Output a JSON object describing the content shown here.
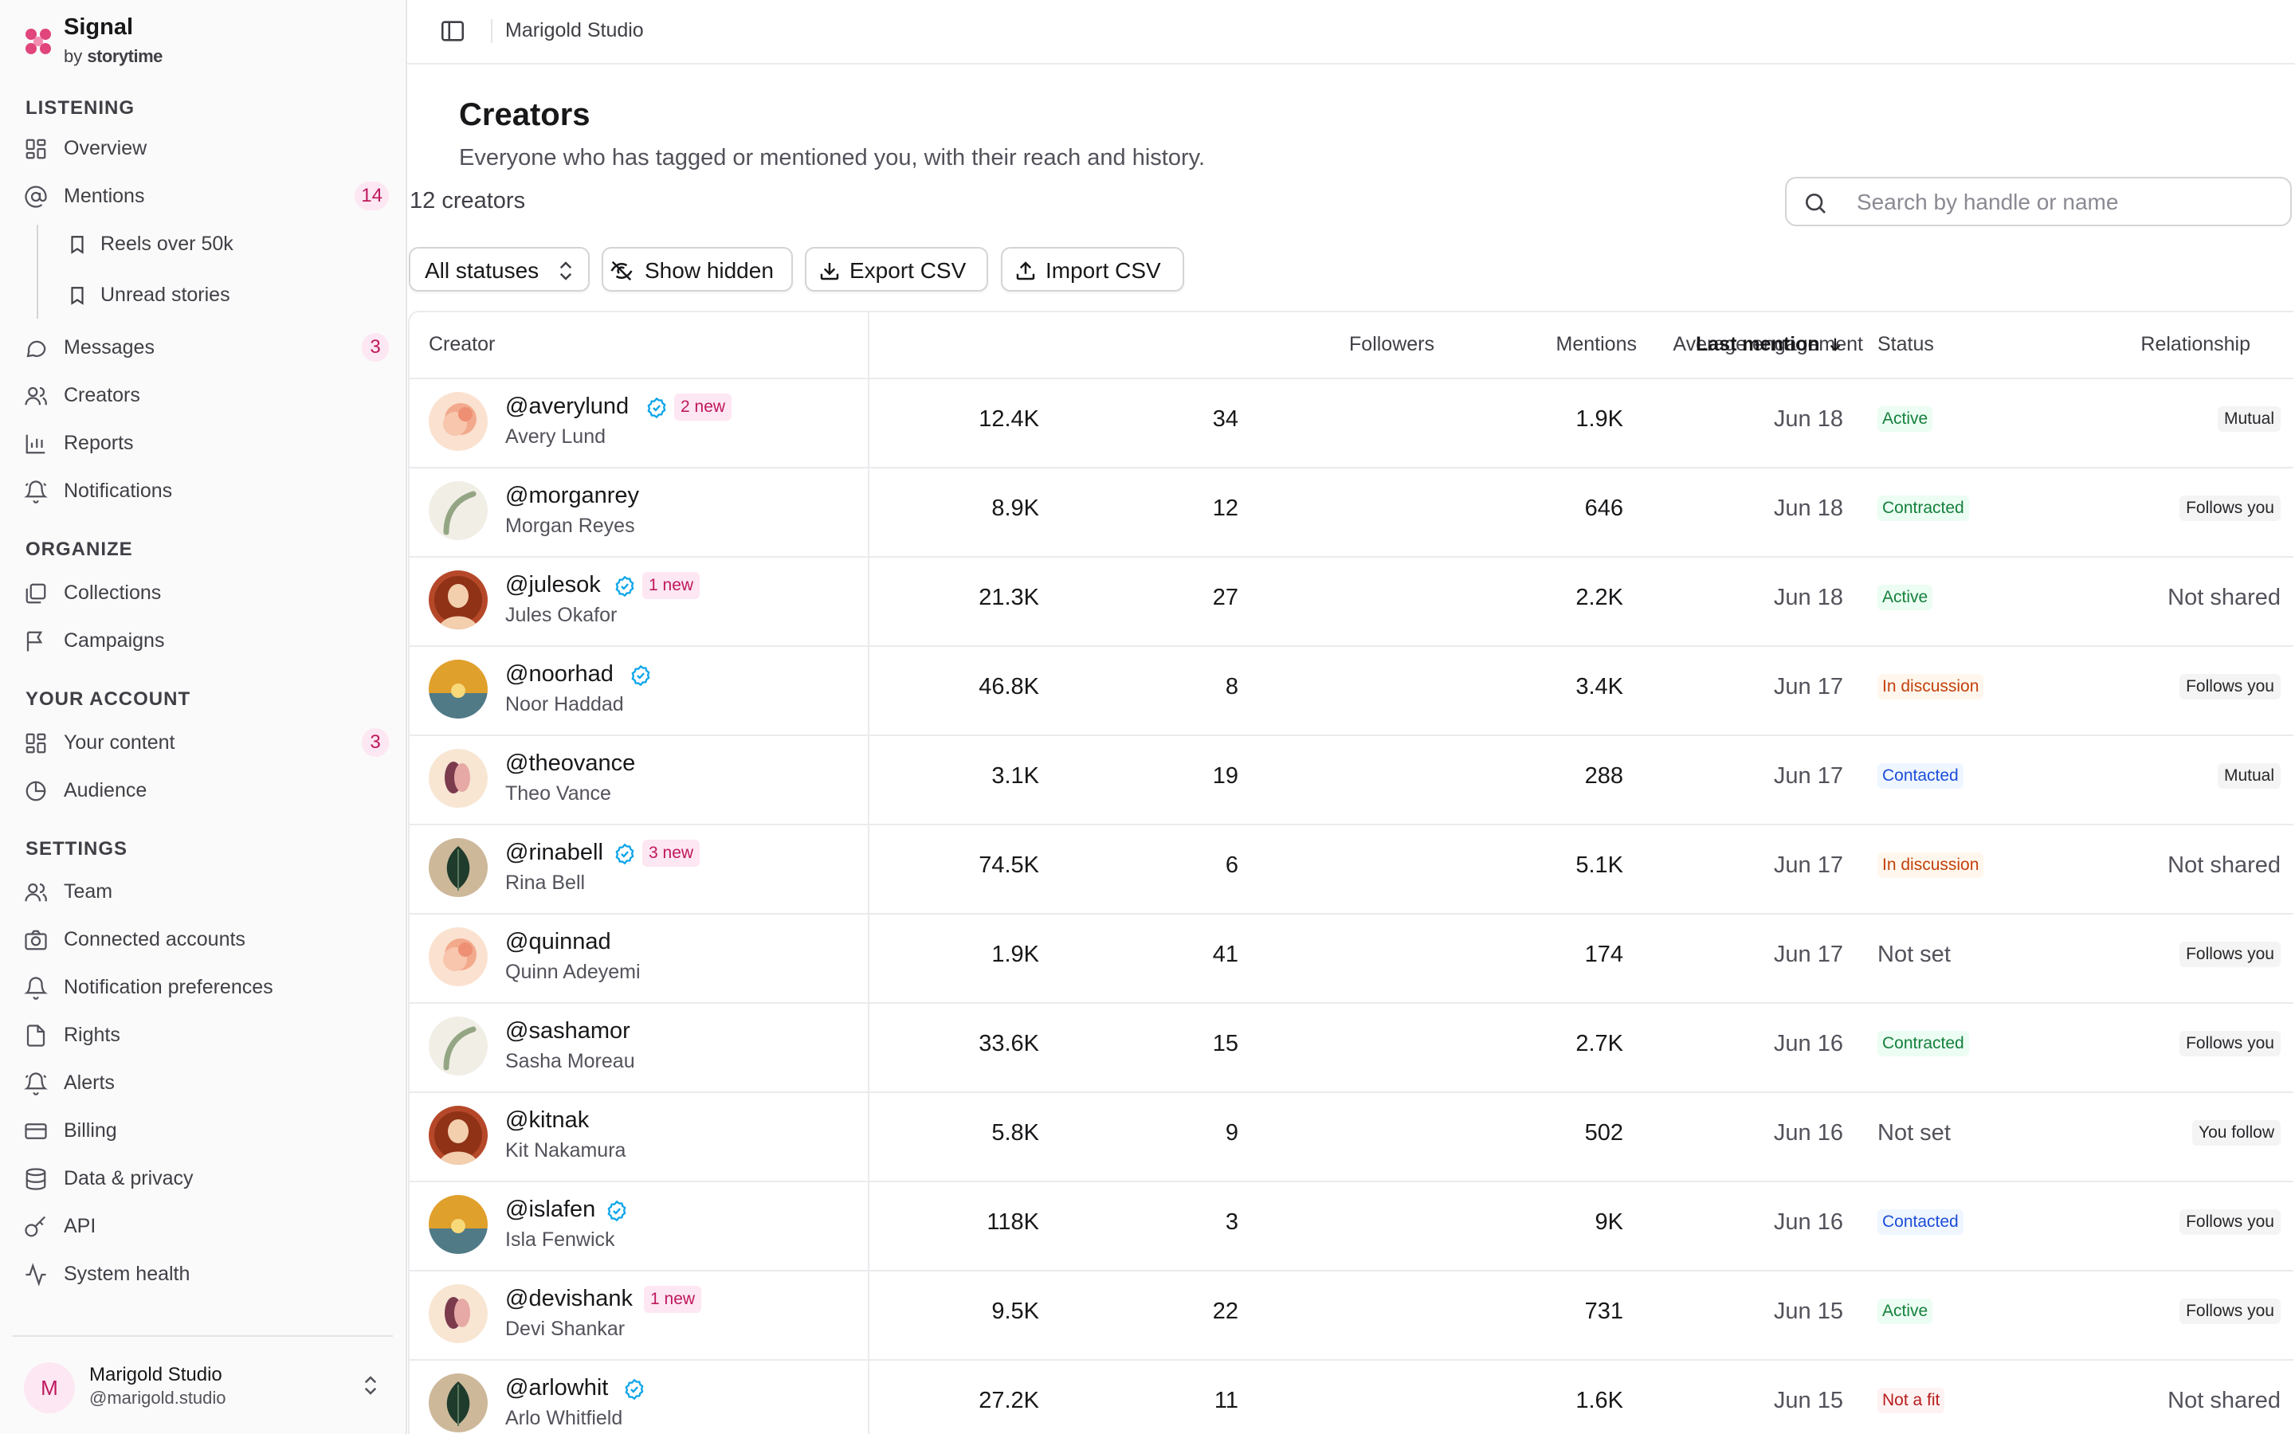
{
  "brand": {
    "name": "Signal",
    "by": "by",
    "company": "storytime",
    "logo_color": "#e0457b"
  },
  "sidebar": {
    "sections": [
      {
        "label": "LISTENING"
      },
      {
        "label": "ORGANIZE"
      },
      {
        "label": "YOUR ACCOUNT"
      },
      {
        "label": "SETTINGS"
      }
    ],
    "items": [
      {
        "label": "Overview",
        "icon": "grid-icon"
      },
      {
        "label": "Mentions",
        "icon": "at-icon",
        "badge": "14"
      },
      {
        "label": "Reels over 50k",
        "icon": "bookmark-icon"
      },
      {
        "label": "Unread stories",
        "icon": "bookmark-icon"
      },
      {
        "label": "Messages",
        "icon": "chat-icon",
        "badge": "3"
      },
      {
        "label": "Creators",
        "icon": "users-icon"
      },
      {
        "label": "Reports",
        "icon": "bar-chart-icon"
      },
      {
        "label": "Notifications",
        "icon": "bell-icon"
      },
      {
        "label": "Collections",
        "icon": "folders-icon"
      },
      {
        "label": "Campaigns",
        "icon": "flag-icon"
      },
      {
        "label": "Your content",
        "icon": "grid-icon",
        "badge": "3"
      },
      {
        "label": "Audience",
        "icon": "pie-icon"
      },
      {
        "label": "Team",
        "icon": "users-icon"
      },
      {
        "label": "Connected accounts",
        "icon": "camera-icon"
      },
      {
        "label": "Notification preferences",
        "icon": "bell-icon"
      },
      {
        "label": "Rights",
        "icon": "document-icon"
      },
      {
        "label": "Alerts",
        "icon": "alarm-icon"
      },
      {
        "label": "Billing",
        "icon": "credit-card-icon"
      },
      {
        "label": "Data & privacy",
        "icon": "database-icon"
      },
      {
        "label": "API",
        "icon": "key-icon"
      },
      {
        "label": "System health",
        "icon": "activity-icon"
      }
    ],
    "account": {
      "initial": "M",
      "name": "Marigold Studio",
      "handle": "@marigold.studio"
    }
  },
  "topbar": {
    "breadcrumb": "Marigold Studio"
  },
  "page": {
    "title": "Creators",
    "description": "Everyone who has tagged or mentioned you, with their reach and history.",
    "count": "12 creators"
  },
  "search": {
    "placeholder": "Search by handle or name",
    "value": ""
  },
  "toolbar": {
    "status_filter": "All statuses",
    "show_hidden": "Show hidden",
    "export": "Export CSV",
    "import": "Import CSV"
  },
  "table": {
    "columns": {
      "creator": "Creator",
      "followers": "Followers",
      "mentions": "Mentions",
      "engagement": "Average engagement",
      "last_mention": "Last mention",
      "status": "Status",
      "relationship": "Relationship"
    },
    "sort": {
      "column": "last_mention",
      "direction": "descending"
    },
    "rows": [
      {
        "handle": "@averylund",
        "name": "Avery Lund",
        "verified": true,
        "new_badge": "2 new",
        "followers": "12.4K",
        "mentions": "34",
        "engagement": "1.9K",
        "last_mention": "Jun 18",
        "status": "Active",
        "status_kind": "active",
        "relationship": "Mutual",
        "relationship_kind": "pill",
        "avatar": "peach"
      },
      {
        "handle": "@morganrey",
        "name": "Morgan Reyes",
        "verified": false,
        "new_badge": "",
        "followers": "8.9K",
        "mentions": "12",
        "engagement": "646",
        "last_mention": "Jun 18",
        "status": "Contracted",
        "status_kind": "contracted",
        "relationship": "Follows you",
        "relationship_kind": "pill",
        "avatar": "arc"
      },
      {
        "handle": "@julesok",
        "name": "Jules Okafor",
        "verified": true,
        "new_badge": "1 new",
        "followers": "21.3K",
        "mentions": "27",
        "engagement": "2.2K",
        "last_mention": "Jun 18",
        "status": "Active",
        "status_kind": "active",
        "relationship": "Not shared",
        "relationship_kind": "plain",
        "avatar": "portrait"
      },
      {
        "handle": "@noorhad",
        "name": "Noor Haddad",
        "verified": true,
        "new_badge": "",
        "followers": "46.8K",
        "mentions": "8",
        "engagement": "3.4K",
        "last_mention": "Jun 17",
        "status": "In discussion",
        "status_kind": "discussion",
        "relationship": "Follows you",
        "relationship_kind": "pill",
        "avatar": "sunset"
      },
      {
        "handle": "@theovance",
        "name": "Theo Vance",
        "verified": false,
        "new_badge": "",
        "followers": "3.1K",
        "mentions": "19",
        "engagement": "288",
        "last_mention": "Jun 17",
        "status": "Contacted",
        "status_kind": "contacted",
        "relationship": "Mutual",
        "relationship_kind": "pill",
        "avatar": "petals"
      },
      {
        "handle": "@rinabell",
        "name": "Rina Bell",
        "verified": true,
        "new_badge": "3 new",
        "followers": "74.5K",
        "mentions": "6",
        "engagement": "5.1K",
        "last_mention": "Jun 17",
        "status": "In discussion",
        "status_kind": "discussion",
        "relationship": "Not shared",
        "relationship_kind": "plain",
        "avatar": "leaf"
      },
      {
        "handle": "@quinnad",
        "name": "Quinn Adeyemi",
        "verified": false,
        "new_badge": "",
        "followers": "1.9K",
        "mentions": "41",
        "engagement": "174",
        "last_mention": "Jun 17",
        "status": "Not set",
        "status_kind": "notset",
        "relationship": "Follows you",
        "relationship_kind": "pill",
        "avatar": "peach"
      },
      {
        "handle": "@sashamor",
        "name": "Sasha Moreau",
        "verified": false,
        "new_badge": "",
        "followers": "33.6K",
        "mentions": "15",
        "engagement": "2.7K",
        "last_mention": "Jun 16",
        "status": "Contracted",
        "status_kind": "contracted",
        "relationship": "Follows you",
        "relationship_kind": "pill",
        "avatar": "arc"
      },
      {
        "handle": "@kitnak",
        "name": "Kit Nakamura",
        "verified": false,
        "new_badge": "",
        "followers": "5.8K",
        "mentions": "9",
        "engagement": "502",
        "last_mention": "Jun 16",
        "status": "Not set",
        "status_kind": "notset",
        "relationship": "You follow",
        "relationship_kind": "pill",
        "avatar": "portrait"
      },
      {
        "handle": "@islafen",
        "name": "Isla Fenwick",
        "verified": true,
        "new_badge": "",
        "followers": "118K",
        "mentions": "3",
        "engagement": "9K",
        "last_mention": "Jun 16",
        "status": "Contacted",
        "status_kind": "contacted",
        "relationship": "Follows you",
        "relationship_kind": "pill",
        "avatar": "sunset"
      },
      {
        "handle": "@devishank",
        "name": "Devi Shankar",
        "verified": false,
        "new_badge": "1 new",
        "followers": "9.5K",
        "mentions": "22",
        "engagement": "731",
        "last_mention": "Jun 15",
        "status": "Active",
        "status_kind": "active",
        "relationship": "Follows you",
        "relationship_kind": "pill",
        "avatar": "petals"
      },
      {
        "handle": "@arlowhit",
        "name": "Arlo Whitfield",
        "verified": true,
        "new_badge": "",
        "followers": "27.2K",
        "mentions": "11",
        "engagement": "1.6K",
        "last_mention": "Jun 15",
        "status": "Not a fit",
        "status_kind": "notfit",
        "relationship": "Not shared",
        "relationship_kind": "plain",
        "avatar": "leaf"
      }
    ]
  }
}
